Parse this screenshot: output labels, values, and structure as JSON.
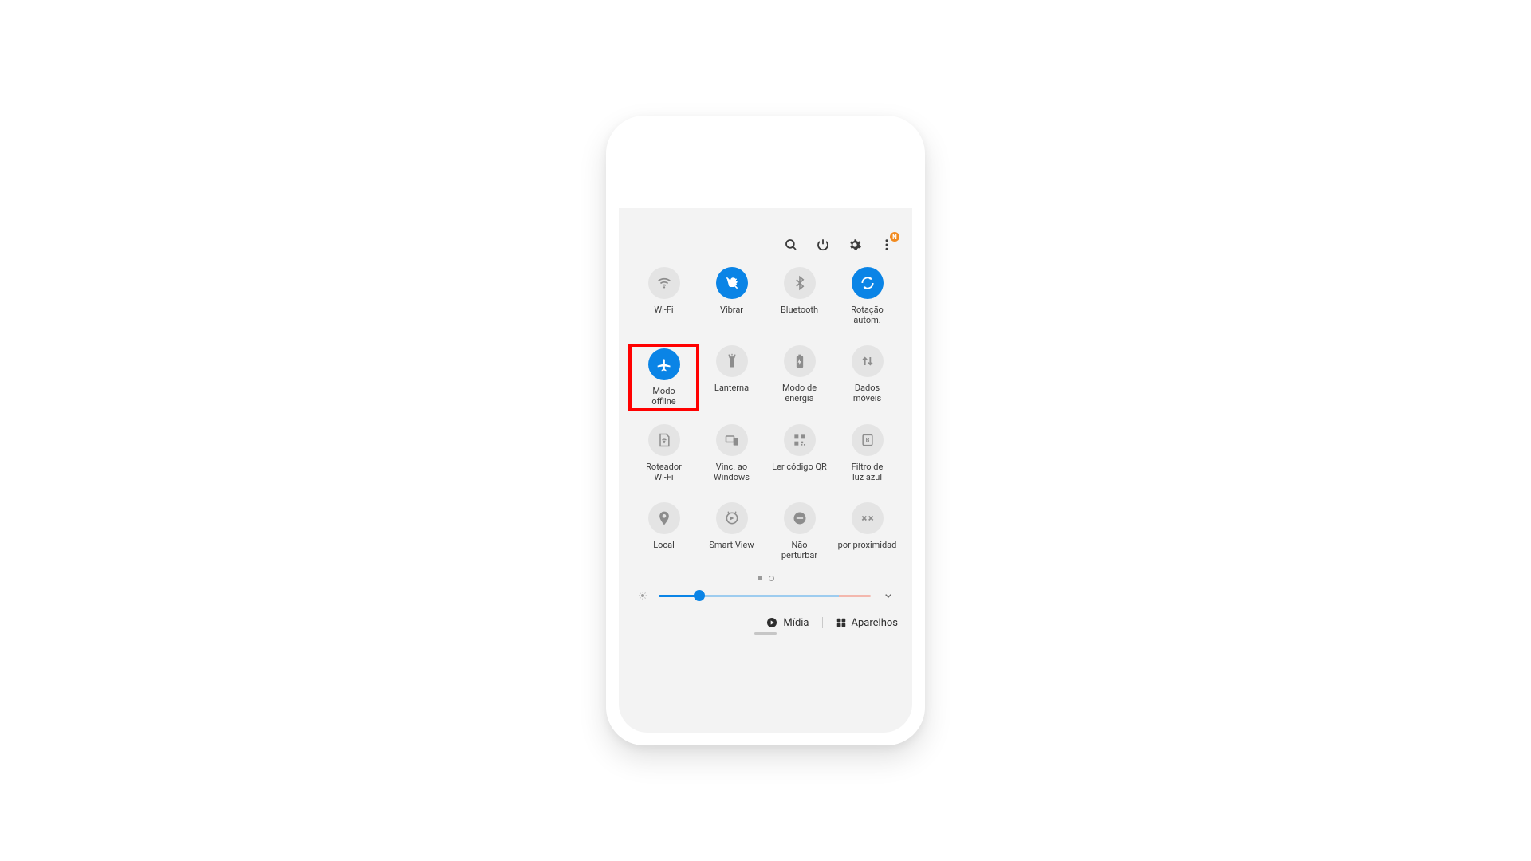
{
  "colors": {
    "accent": "#0a84e6",
    "highlight": "#ff0000",
    "badge": "#f18a1f"
  },
  "topbar": {
    "badge": "N"
  },
  "tiles": {
    "wifi": {
      "label": "Wi-Fi",
      "active": false
    },
    "vibrate": {
      "label": "Vibrar",
      "active": true
    },
    "bluetooth": {
      "label": "Bluetooth",
      "active": false
    },
    "rotation": {
      "label": "Rotação\nautom.",
      "active": true
    },
    "airplane": {
      "label": "Modo\noffline",
      "active": true,
      "highlighted": true
    },
    "flashlight": {
      "label": "Lanterna",
      "active": false
    },
    "powersave": {
      "label": "Modo de\nenergia",
      "active": false
    },
    "mobiledata": {
      "label": "Dados\nmóveis",
      "active": false
    },
    "hotspot": {
      "label": "Roteador\nWi-Fi",
      "active": false
    },
    "winlink": {
      "label": "Vinc. ao\nWindows",
      "active": false
    },
    "qrscan": {
      "label": "Ler código QR",
      "active": false
    },
    "bluelight": {
      "label": "Filtro de\nluz azul",
      "active": false
    },
    "location": {
      "label": "Local",
      "active": false
    },
    "smartview": {
      "label": "Smart View",
      "active": false
    },
    "dnd": {
      "label": "Não\nperturbar",
      "active": false
    },
    "nearby": {
      "label": "por proximidad",
      "active": false
    }
  },
  "pager": {
    "current": 1,
    "total": 2
  },
  "brightness": {
    "value_percent": 19
  },
  "bottombar": {
    "media": "Mídia",
    "devices": "Aparelhos"
  }
}
